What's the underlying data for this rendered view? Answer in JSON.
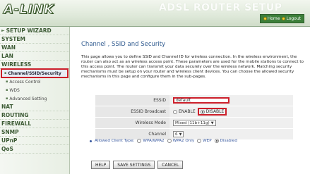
{
  "header": {
    "logo": "A-LINK",
    "watermark": "ADSL ROUTER SETUP",
    "links": [
      {
        "label": "Home",
        "icon": "home-icon"
      },
      {
        "label": "Logout",
        "icon": "logout-icon"
      }
    ]
  },
  "sidebar": {
    "items": [
      {
        "label": "SETUP WIZARD",
        "type": "top",
        "arrow": true
      },
      {
        "label": "SYSTEM",
        "type": "top"
      },
      {
        "label": "WAN",
        "type": "top"
      },
      {
        "label": "LAN",
        "type": "top"
      },
      {
        "label": "WIRELESS",
        "type": "top"
      },
      {
        "label": "Channel/SSID/Security",
        "type": "sub",
        "active": true
      },
      {
        "label": "Access Control",
        "type": "sub"
      },
      {
        "label": "WDS",
        "type": "sub"
      },
      {
        "label": "Advanced Setting",
        "type": "sub"
      },
      {
        "label": "NAT",
        "type": "top"
      },
      {
        "label": "ROUTING",
        "type": "top"
      },
      {
        "label": "FIREWALL",
        "type": "top"
      },
      {
        "label": "SNMP",
        "type": "top"
      },
      {
        "label": "UPnP",
        "type": "top"
      },
      {
        "label": "QoS",
        "type": "top"
      }
    ]
  },
  "main": {
    "title": "Channel , SSID and Security",
    "description": "This page allows you to define SSID and Channel ID for wireless connection. In the wireless environment, the router can also act as an wireless access point. These parameters are used for the mobile stations to connect to this access point. The router can transmit your data securely over the wireless network. Matching security mechanisms must be setup on your router and wireless client devices. You can choose the allowed security mechanisms in this page and configure them in the sub-pages.",
    "form": {
      "ssid_label": "ESSID",
      "ssid_value": "default",
      "broadcast_label": "ESSID Broadcast",
      "broadcast_options": [
        "ENABLE",
        "DISABLE"
      ],
      "broadcast_selected": "DISABLE",
      "mode_label": "Wireless Mode",
      "mode_value": "Mixed (11b+11g)",
      "channel_label": "Channel",
      "channel_value": "6"
    },
    "allowed": {
      "label": "Allowed Client Type:",
      "options": [
        "WPA/WPA2",
        "WPA2 Only",
        "WEP",
        "Disabled"
      ],
      "selected": "Disabled"
    },
    "buttons": {
      "help": "HELP",
      "save": "SAVE SETTINGS",
      "cancel": "CANCEL"
    }
  },
  "colors": {
    "accent": "#cc1f2a",
    "title": "#2f5a8f",
    "sidebar_text": "#3c5a34",
    "header_links_bg": "#3d7f3a"
  }
}
